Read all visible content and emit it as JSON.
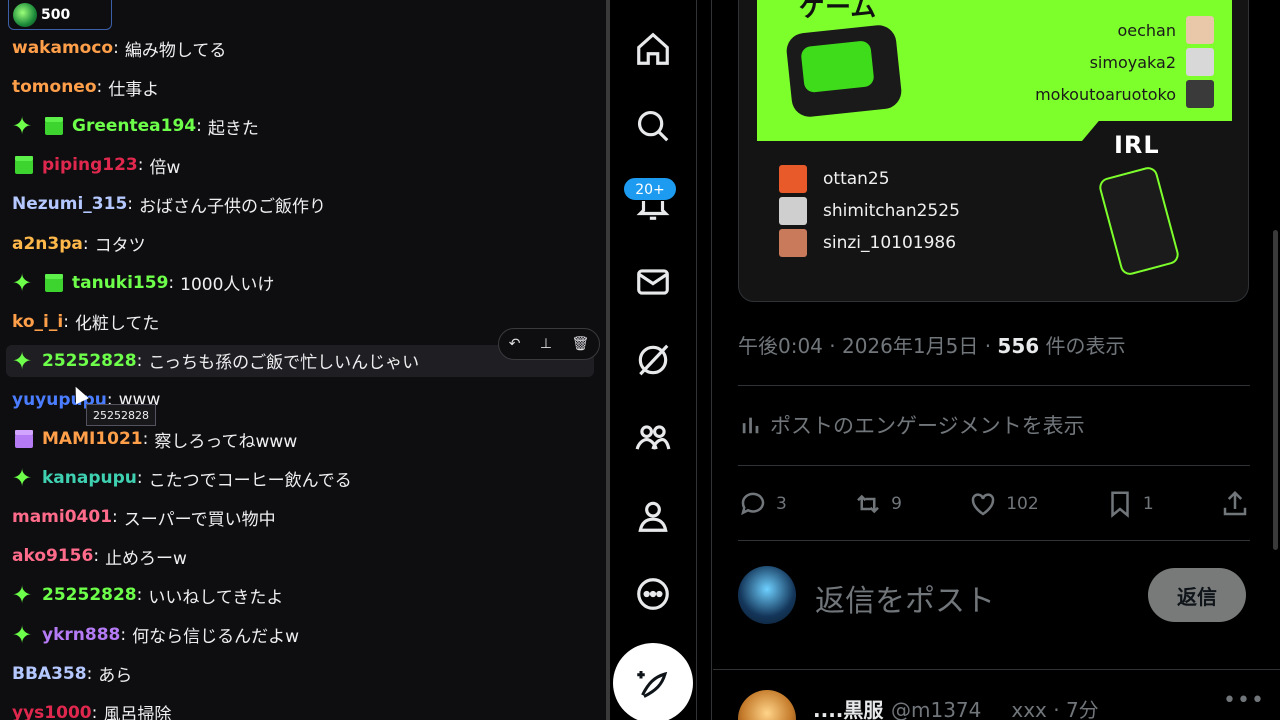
{
  "chat": {
    "points": "500",
    "messages": [
      {
        "user": "wakamoco",
        "color": "#ff9f4a",
        "badges": [],
        "text": "編み物してる"
      },
      {
        "user": "tomoneo",
        "color": "#ff9f4a",
        "badges": [],
        "text": "仕事よ"
      },
      {
        "user": "Greentea194",
        "color": "#6dff4a",
        "badges": [
          "sparkle",
          "gift"
        ],
        "text": "起きた"
      },
      {
        "user": "piping123",
        "color": "#e0284e",
        "badges": [
          "gift"
        ],
        "text": "倍w"
      },
      {
        "user": "Nezumi_315",
        "color": "#b4c8ff",
        "badges": [],
        "text": "おばさん子供のご飯作り"
      },
      {
        "user": "a2n3pa",
        "color": "#ffb84a",
        "badges": [],
        "text": "コタツ"
      },
      {
        "user": "tanuki159",
        "color": "#6dff4a",
        "badges": [
          "sparkle",
          "gift"
        ],
        "text": "1000人いけ"
      },
      {
        "user": "ko_i_i",
        "color": "#ff9f4a",
        "badges": [],
        "text": "化粧してた"
      },
      {
        "user": "25252828",
        "color": "#6dff4a",
        "badges": [
          "sparkle"
        ],
        "text": "こっちも孫のご飯で忙しいんじゃい",
        "highlight": true
      },
      {
        "user": "yuyupupu",
        "color": "#4a7dff",
        "badges": [],
        "text": "www"
      },
      {
        "user": "MAMI1021",
        "color": "#ff9f4a",
        "badges": [
          "gift-purple"
        ],
        "text": "察しろってねwww"
      },
      {
        "user": "kanapupu",
        "color": "#3ed0b0",
        "badges": [
          "sparkle"
        ],
        "text": "こたつでコーヒー飲んでる"
      },
      {
        "user": "mami0401",
        "color": "#ff6b8a",
        "badges": [],
        "text": "スーパーで買い物中"
      },
      {
        "user": "ako9156",
        "color": "#ff6b8a",
        "badges": [],
        "text": "止めろーw"
      },
      {
        "user": "25252828",
        "color": "#6dff4a",
        "badges": [
          "sparkle"
        ],
        "text": "いいねしてきたよ"
      },
      {
        "user": "ykrn888",
        "color": "#b57bf5",
        "badges": [
          "sparkle"
        ],
        "text": "何なら信じるんだよw"
      },
      {
        "user": "BBA358",
        "color": "#b4c8ff",
        "badges": [],
        "text": "あら"
      },
      {
        "user": "yys1000",
        "color": "#e0284e",
        "badges": [],
        "text": "風呂掃除"
      }
    ],
    "tooltip": "25252828",
    "actions": [
      "reply-icon",
      "pin-icon",
      "delete-icon"
    ]
  },
  "nav": {
    "items": [
      "home-icon",
      "search-icon",
      "notifications-icon",
      "messages-icon",
      "grok-icon",
      "communities-icon",
      "profile-icon",
      "more-icon"
    ],
    "notif_count": "20+"
  },
  "card": {
    "green_title": "ゲーム",
    "green_names": [
      "oechan",
      "simoyaka2",
      "mokoutoaruotoko"
    ],
    "irl_label": "IRL",
    "irl_names": [
      "ottan25",
      "shimitchan2525",
      "sinzi_10101986"
    ]
  },
  "post": {
    "time": "午後0:04 · 2026年1月5日 · ",
    "views_count": "556",
    "views_suffix": " 件の表示",
    "engagement": "ポストのエンゲージメントを表示",
    "replies": "3",
    "reposts": "9",
    "likes": "102",
    "bookmarks": "1"
  },
  "reply": {
    "placeholder": "返信をポスト",
    "button": "返信"
  },
  "next_post": {
    "name": "....黒服",
    "handle": "@m1374___xxx · 7分"
  },
  "colors": {
    "accent": "#1d9bf0",
    "card_green": "#7dff2c"
  }
}
